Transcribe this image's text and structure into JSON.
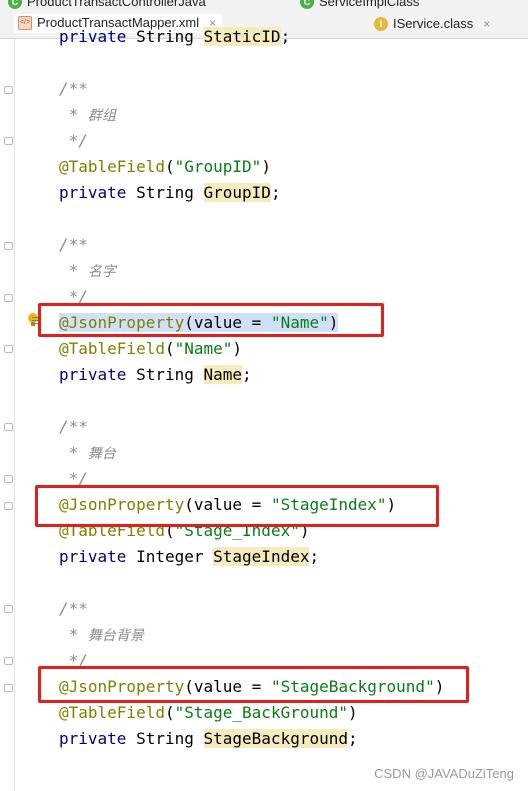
{
  "tabs": {
    "row1": [
      {
        "label": "ProductTransactControllerJava",
        "icon": "java-file-icon"
      },
      {
        "label": "ServiceImplClass",
        "icon": "class-file-icon"
      }
    ],
    "row2": [
      {
        "label": "ProductTransactMapper.xml",
        "icon": "xml-file-icon",
        "close": "×"
      },
      {
        "label": "IService.class",
        "icon": "interface-class-icon",
        "close": "×",
        "badge": "I"
      }
    ]
  },
  "code": {
    "l0": {
      "kw": "private",
      "type": " String ",
      "ident": "StaticID",
      "end": ";"
    },
    "b1": {
      "open": "/**",
      "star": " * ",
      "text": "群组",
      "close": " */"
    },
    "groupid": {
      "ann": "@TableField",
      "lp": "(",
      "str": "\"GroupID\"",
      "rp": ")",
      "kw": "private",
      "type": " String ",
      "ident": "GroupID",
      "end": ";"
    },
    "b2": {
      "open": "/**",
      "star": " * ",
      "text": "名字",
      "close": " */"
    },
    "name": {
      "json_ann": "@JsonProperty",
      "json_args_pre": "(value = ",
      "json_str": "\"Name\"",
      "json_rp": ")",
      "ann": "@TableField",
      "lp": "(",
      "str": "\"Name\"",
      "rp": ")",
      "kw": "private",
      "type": " String ",
      "ident": "Name",
      "end": ";"
    },
    "b3": {
      "open": "/**",
      "star": " * ",
      "text": "舞台",
      "close": " */"
    },
    "stage": {
      "json_ann": "@JsonProperty",
      "json_args_pre": "(value = ",
      "json_str": "\"StageIndex\"",
      "json_rp": ")",
      "ann": "@TableField",
      "lp": "(",
      "str": "\"Stage_Index\"",
      "rp": ")",
      "kw": "private",
      "type": " Integer ",
      "ident": "StageIndex",
      "end": ";"
    },
    "b4": {
      "open": "/**",
      "star": " * ",
      "text": "舞台背景",
      "close": " */"
    },
    "bg": {
      "json_ann": "@JsonProperty",
      "json_args_pre": "(value = ",
      "json_str": "\"StageBackground\"",
      "json_rp": ")",
      "ann": "@TableField",
      "lp": "(",
      "str": "\"Stage_BackGround\"",
      "rp": ")",
      "kw": "private",
      "type": " String ",
      "ident": "StageBackground",
      "end": ";"
    }
  },
  "watermark": "CSDN @JAVADuZiTeng",
  "colors": {
    "keyword": "#000080",
    "annotation": "#808000",
    "string": "#067d17",
    "comment": "#8c8c8c",
    "highlight_box": "#e0201c"
  }
}
